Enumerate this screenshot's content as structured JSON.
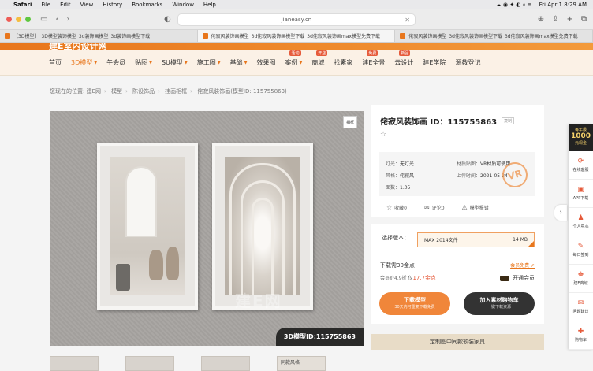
{
  "menubar": {
    "app": "Safari",
    "items": [
      "File",
      "Edit",
      "View",
      "History",
      "Bookmarks",
      "Window",
      "Help"
    ],
    "clock": "Fri Apr 1  8:29 AM"
  },
  "browser": {
    "url": "jianeasy.cn",
    "tabs": [
      "【3D模型】_3D模型装饰模型_3d装饰画模型_3d装饰画模型下载",
      "侘寂风装饰画模型_3d侘寂风装饰画模型下载_3d侘寂风装饰画max模型免费下载",
      "侘寂风装饰画模型_3d侘寂风装饰画模型下载_3d侘寂风装饰画max模型免费下载"
    ]
  },
  "site": {
    "logo": "建E室内设计网"
  },
  "nav": {
    "items": [
      {
        "label": "首页"
      },
      {
        "label": "3D模型",
        "active": true,
        "caret": true
      },
      {
        "label": "午会员"
      },
      {
        "label": "贴图",
        "caret": true
      },
      {
        "label": "SU模型",
        "caret": true
      },
      {
        "label": "施工图",
        "caret": true
      },
      {
        "label": "基础",
        "caret": true
      },
      {
        "label": "效果图"
      },
      {
        "label": "案例",
        "caret": true,
        "badge": "活动"
      },
      {
        "label": "商城",
        "badge": "开店"
      },
      {
        "label": "找素家"
      },
      {
        "label": "建E全景",
        "badge": "免费"
      },
      {
        "label": "云设计",
        "badge": "新品"
      },
      {
        "label": "建E学院"
      },
      {
        "label": "源教登记"
      }
    ]
  },
  "breadcrumb": [
    "您现在的位置: 建E网",
    "模型",
    "陈设饰品",
    "挂画相框",
    "侘寂风装饰画(模型ID: 115755863)"
  ],
  "hero": {
    "tag": "相框",
    "watermark": "建E网",
    "id_badge": "3D模型ID:115755863"
  },
  "thumbs": [
    "",
    "",
    "",
    "同款风格"
  ],
  "product": {
    "title": "侘寂风装饰画 ID：115755863",
    "copy": "复制",
    "specs": [
      {
        "k": "灯光：",
        "v": "无灯光",
        "k2": "材质贴图：",
        "v2": "VR材质可使用"
      },
      {
        "k": "风格：",
        "v": "侘寂风",
        "k2": "上传时间：",
        "v2": "2021-05-24"
      },
      {
        "k": "面数：",
        "v": "1.05",
        "k2": "",
        "v2": ""
      }
    ],
    "stamp": "VR",
    "actions": [
      {
        "icon": "☆",
        "label": "收藏0"
      },
      {
        "icon": "✉",
        "label": "评论0"
      },
      {
        "icon": "⚠",
        "label": "模型报错"
      }
    ]
  },
  "download": {
    "version_label": "选择版本：",
    "version_value": "MAX 2014文件",
    "version_size": "14 MB",
    "cost": "下载需30金点",
    "member_link": "会员免费 ↗",
    "price_prefix": "会员价4.9折 仅",
    "price_red": "17.7金点",
    "open_vip": "开通会员",
    "btn_download": {
      "l1": "下载模型",
      "l2": "30天内可重复下载免费"
    },
    "btn_library": {
      "l1": "加入素材购物车",
      "l2": "一键下载资源"
    },
    "custom": "定制图中同款软装家具"
  },
  "sidebar": {
    "promo": {
      "top": "每年最",
      "big": "1000",
      "bottom": "元现金"
    },
    "items": [
      {
        "icon": "⟳",
        "label": "在线客服"
      },
      {
        "icon": "▣",
        "label": "APP下载"
      },
      {
        "icon": "♟",
        "label": "个人中心"
      },
      {
        "icon": "✎",
        "label": "每日签到"
      },
      {
        "icon": "♚",
        "label": "建E商城"
      },
      {
        "icon": "✉",
        "label": "问题建议"
      },
      {
        "icon": "✚",
        "label": "购物车"
      }
    ]
  },
  "colors": {
    "accent": "#e8761c",
    "nav_bg": "#fbf1e6",
    "dark_button": "#333333"
  }
}
